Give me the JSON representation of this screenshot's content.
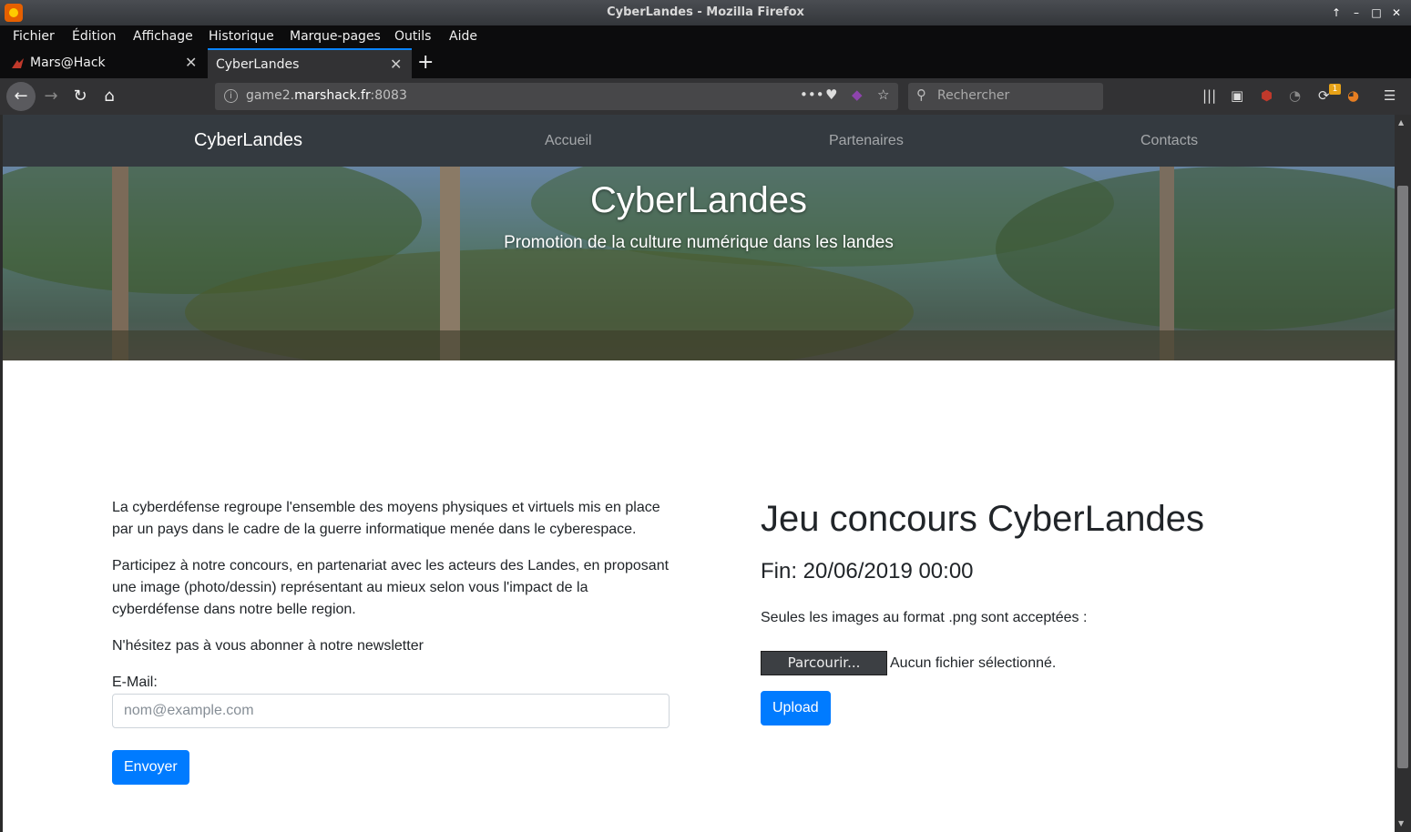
{
  "window": {
    "title": "CyberLandes - Mozilla Firefox"
  },
  "menubar": [
    "Fichier",
    "Édition",
    "Affichage",
    "Historique",
    "Marque-pages",
    "Outils",
    "Aide"
  ],
  "tabs": [
    {
      "label": "Mars@Hack",
      "active": false
    },
    {
      "label": "CyberLandes",
      "active": true
    }
  ],
  "urlbar": {
    "prefix": "game2.",
    "domain": "marshack.fr",
    "port": ":8083"
  },
  "search": {
    "placeholder": "Rechercher"
  },
  "toolbar": {
    "notification_count": "1"
  },
  "site": {
    "brand": "CyberLandes",
    "nav": [
      "Accueil",
      "Partenaires",
      "Contacts"
    ],
    "hero": {
      "title": "CyberLandes",
      "subtitle": "Promotion de la culture numérique dans les landes"
    },
    "left": {
      "p1": "La cyberdéfense regroupe l'ensemble des moyens physiques et virtuels mis en place par un pays dans le cadre de la guerre informatique menée dans le cyberespace.",
      "p2": "Participez à notre concours, en partenariat avec les acteurs des Landes, en proposant une image (photo/dessin) représentant au mieux selon vous l'impact de la cyberdéfense dans notre belle region.",
      "p3": "N'hésitez pas à vous abonner à notre newsletter",
      "email_label": "E-Mail:",
      "email_placeholder": "nom@example.com",
      "submit": "Envoyer"
    },
    "right": {
      "title": "Jeu concours CyberLandes",
      "deadline": "Fin: 20/06/2019 00:00",
      "note": "Seules les images au format .png sont acceptées :",
      "browse": "Parcourir...",
      "no_file": "Aucun fichier sélectionné.",
      "upload": "Upload"
    }
  }
}
